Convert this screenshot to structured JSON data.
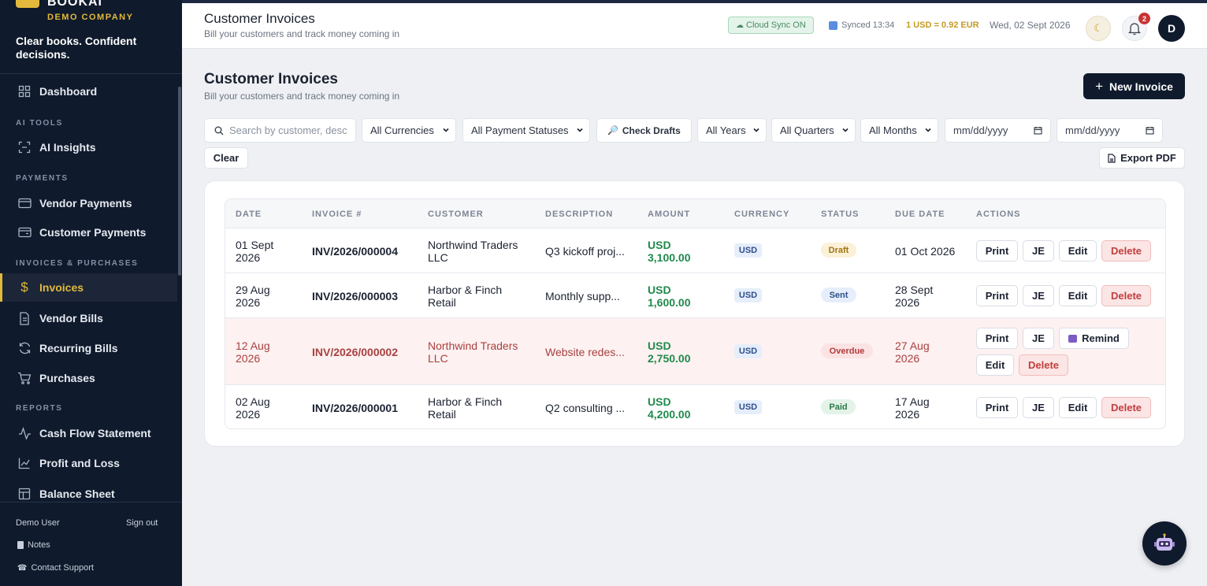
{
  "brand": {
    "name": "BOOKAI",
    "company": "DEMO COMPANY",
    "tagline": "Clear books. Confident decisions."
  },
  "sidebar": {
    "items": [
      {
        "label": "Dashboard",
        "icon": "grid-icon"
      },
      {
        "label": "AI Insights",
        "icon": "scan-icon"
      },
      {
        "label": "Vendor Payments",
        "icon": "card-icon"
      },
      {
        "label": "Customer Payments",
        "icon": "wallet-icon"
      },
      {
        "label": "Invoices",
        "icon": "dollar-icon",
        "active": true
      },
      {
        "label": "Vendor Bills",
        "icon": "document-icon"
      },
      {
        "label": "Recurring Bills",
        "icon": "refresh-icon"
      },
      {
        "label": "Purchases",
        "icon": "cart-icon"
      },
      {
        "label": "Cash Flow Statement",
        "icon": "pulse-icon"
      },
      {
        "label": "Profit and Loss",
        "icon": "chart-icon"
      },
      {
        "label": "Balance Sheet",
        "icon": "table-icon"
      }
    ],
    "sections": [
      "AI TOOLS",
      "PAYMENTS",
      "INVOICES & PURCHASES",
      "REPORTS"
    ],
    "footer": {
      "user": "Demo User",
      "signout": "Sign out",
      "notes": "Notes",
      "support": "Contact Support"
    }
  },
  "topbar": {
    "title": "Customer Invoices",
    "subtitle": "Bill your customers and track money coming in",
    "cloud_sync": "Cloud Sync ON",
    "synced": "Synced 13:34",
    "rate": "1 USD = 0.92 EUR",
    "date": "Wed, 02 Sept 2026",
    "notification_count": "2",
    "avatar_initial": "D"
  },
  "page": {
    "title": "Customer Invoices",
    "subtitle": "Bill your customers and track money coming in",
    "new_invoice": "New Invoice",
    "new_invoice_plus": "+"
  },
  "filters": {
    "search_placeholder": "Search by customer, desc",
    "currency": "All Currencies",
    "payment_status": "All Payment Statuses",
    "check_drafts": "Check Drafts",
    "years": "All Years",
    "quarters": "All Quarters",
    "months": "All Months",
    "date_from": "mm/dd/yyyy",
    "date_to": "mm/dd/yyyy",
    "clear": "Clear",
    "export_pdf": "Export PDF"
  },
  "table": {
    "headers": [
      "DATE",
      "INVOICE #",
      "CUSTOMER",
      "DESCRIPTION",
      "AMOUNT",
      "CURRENCY",
      "STATUS",
      "DUE DATE",
      "ACTIONS"
    ],
    "rows": [
      {
        "date1": "01 Sept",
        "date2": "2026",
        "invoice": "INV/2026/000004",
        "cust1": "Northwind Traders",
        "cust2": "LLC",
        "desc": "Q3 kickoff proj...",
        "amt1": "USD",
        "amt2": "3,100.00",
        "currency": "USD",
        "status": "Draft",
        "due1": "01 Oct 2026",
        "due2": ""
      },
      {
        "date1": "29 Aug",
        "date2": "2026",
        "invoice": "INV/2026/000003",
        "cust1": "Harbor & Finch",
        "cust2": "Retail",
        "desc": "Monthly supp...",
        "amt1": "USD",
        "amt2": "1,600.00",
        "currency": "USD",
        "status": "Sent",
        "due1": "28 Sept",
        "due2": "2026"
      },
      {
        "date1": "12 Aug",
        "date2": "2026",
        "invoice": "INV/2026/000002",
        "cust1": "Northwind Traders",
        "cust2": "LLC",
        "desc": "Website redes...",
        "amt1": "USD",
        "amt2": "2,750.00",
        "currency": "USD",
        "status": "Overdue",
        "due1": "27 Aug",
        "due2": "2026"
      },
      {
        "date1": "02 Aug",
        "date2": "2026",
        "invoice": "INV/2026/000001",
        "cust1": "Harbor & Finch",
        "cust2": "Retail",
        "desc": "Q2 consulting ...",
        "amt1": "USD",
        "amt2": "4,200.00",
        "currency": "USD",
        "status": "Paid",
        "due1": "17 Aug",
        "due2": "2026"
      }
    ],
    "actions": {
      "print": "Print",
      "je": "JE",
      "edit": "Edit",
      "delete": "Delete",
      "remind": "Remind"
    }
  },
  "colors": {
    "sidebar_bg": "#0f1a2c",
    "accent": "#e2b93b",
    "amount": "#1f8a4c",
    "danger": "#c23e3e"
  }
}
